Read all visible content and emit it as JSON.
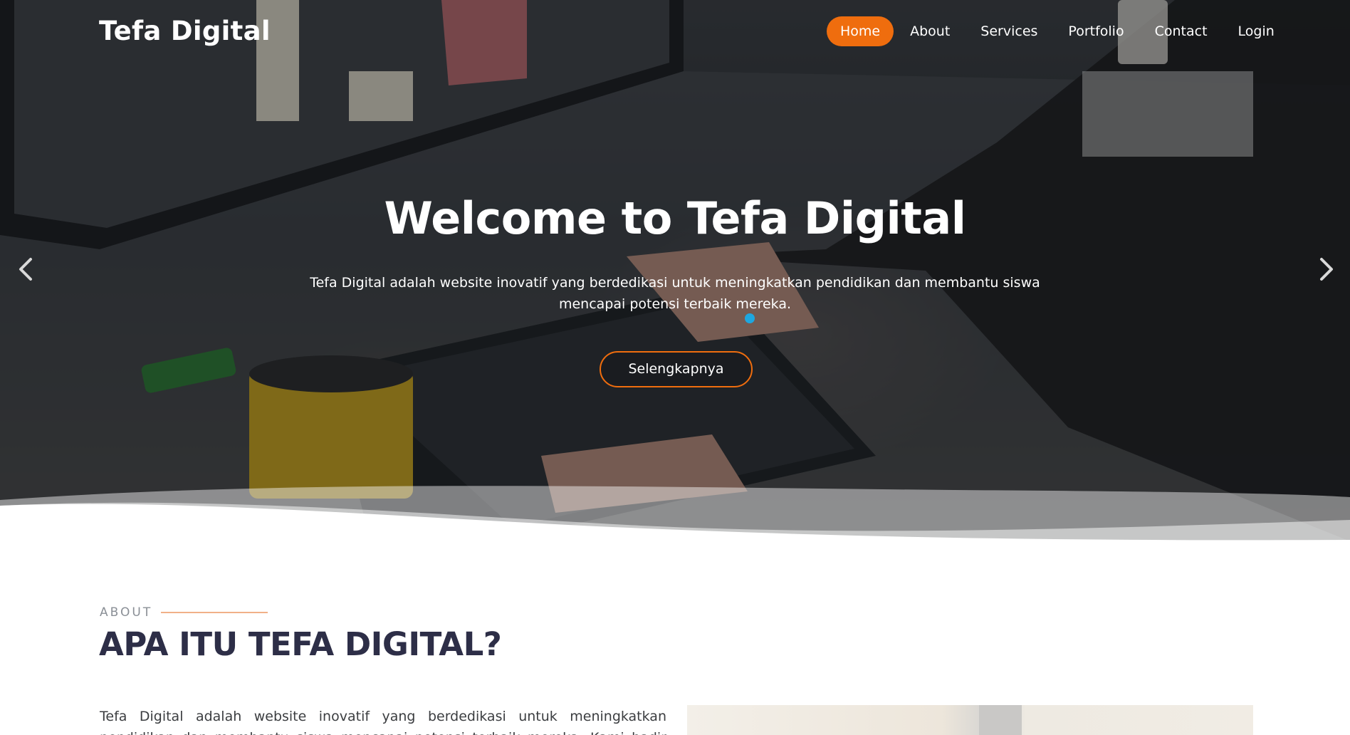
{
  "brand": {
    "name": "Tefa Digital"
  },
  "nav": {
    "items": [
      {
        "label": "Home",
        "active": true
      },
      {
        "label": "About",
        "active": false
      },
      {
        "label": "Services",
        "active": false
      },
      {
        "label": "Portfolio",
        "active": false
      },
      {
        "label": "Contact",
        "active": false
      },
      {
        "label": "Login",
        "active": false
      }
    ]
  },
  "hero": {
    "title": "Welcome to Tefa Digital",
    "subtitle": "Tefa Digital adalah website inovatif yang berdedikasi untuk meningkatkan pendidikan dan membantu siswa mencapai potensi terbaik mereka.",
    "button_label": "Selengkapnya",
    "prev_icon": "chevron-left-icon",
    "next_icon": "chevron-right-icon"
  },
  "about": {
    "eyebrow": "ABOUT",
    "title": "APA ITU TEFA DIGITAL?",
    "text": "Tefa Digital adalah website inovatif yang berdedikasi untuk meningkatkan pendidikan dan membantu siswa mencapai potensi terbaik mereka. Kami hadir dengan visi"
  },
  "colors": {
    "accent": "#ef6d0e",
    "heading": "#2d2e47",
    "dot": "#1ea7e0",
    "eyebrow_line": "#f1b088"
  }
}
